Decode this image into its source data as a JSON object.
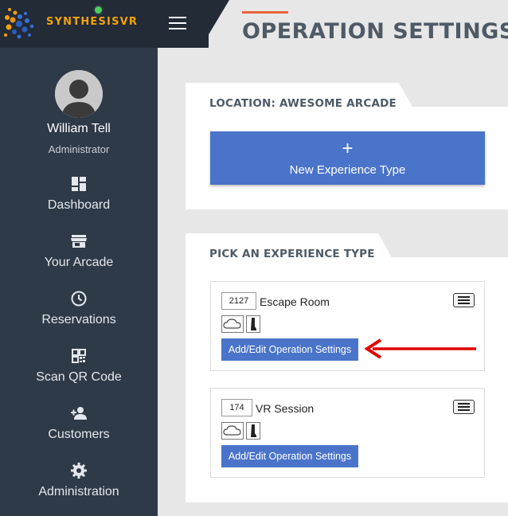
{
  "brand": {
    "name": "SYNTHESISVR",
    "accent": "#f2a20c"
  },
  "header": {
    "title": "OPERATION SETTINGS",
    "accent": "#e8643a"
  },
  "user": {
    "name": "William Tell",
    "role": "Administrator",
    "status_color": "#4cd05a"
  },
  "nav": {
    "items": [
      {
        "label": "Dashboard",
        "icon": "dashboard-icon"
      },
      {
        "label": "Your Arcade",
        "icon": "store-icon"
      },
      {
        "label": "Reservations",
        "icon": "clock-icon"
      },
      {
        "label": "Scan QR Code",
        "icon": "qr-code-icon"
      },
      {
        "label": "Customers",
        "icon": "add-person-icon"
      },
      {
        "label": "Administration",
        "icon": "gear-icon"
      }
    ]
  },
  "location_panel": {
    "heading": "LOCATION: AWESOME ARCADE",
    "new_button": {
      "icon": "+",
      "label": "New Experience Type"
    }
  },
  "experience_panel": {
    "heading": "PICK AN EXPERIENCE TYPE",
    "experiences": [
      {
        "id": "2127",
        "name": "Escape Room",
        "button": "Add/Edit Operation Settings",
        "icons": [
          "cloud-icon",
          "boot-icon"
        ]
      },
      {
        "id": "174",
        "name": "VR Session",
        "button": "Add/Edit Operation Settings",
        "icons": [
          "cloud-icon",
          "boot-icon"
        ]
      }
    ]
  },
  "colors": {
    "sidebar": "#2f3a48",
    "primary_button": "#4a74c9",
    "annotation_arrow": "#e00000"
  }
}
